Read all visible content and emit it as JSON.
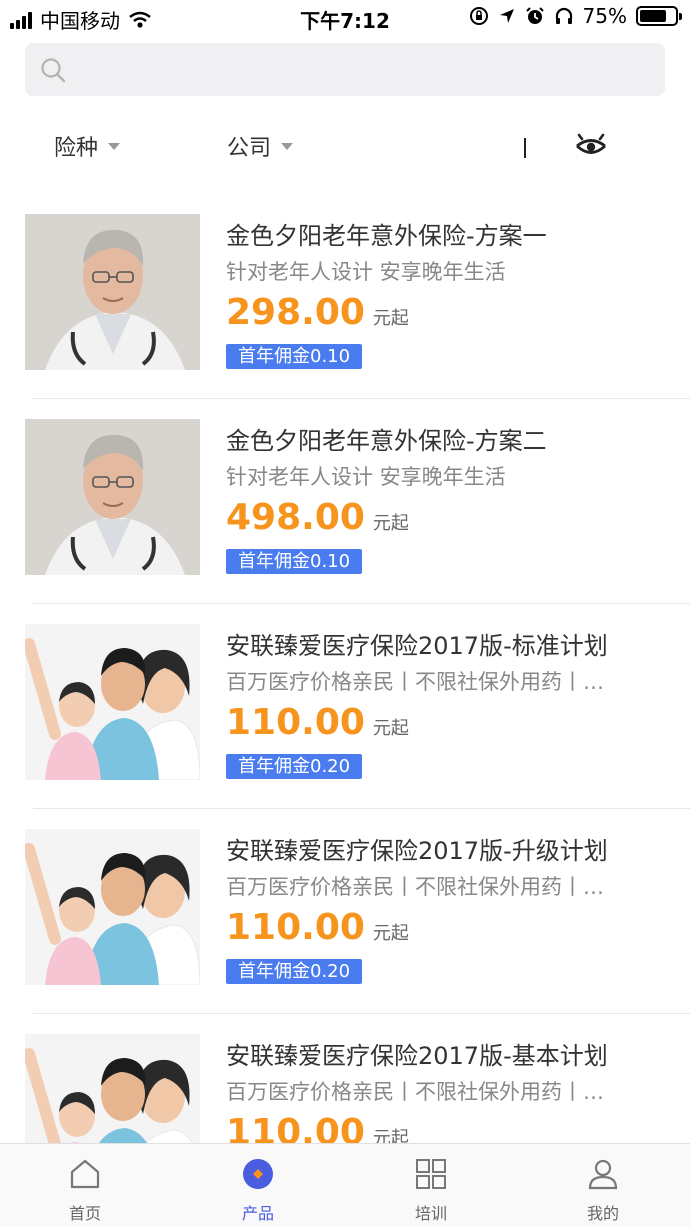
{
  "status_bar": {
    "carrier": "中国移动",
    "time": "下午7:12",
    "battery_percent": "75%",
    "battery_level": 0.75
  },
  "search": {
    "placeholder": ""
  },
  "filters": {
    "insurance_type": "险种",
    "company": "公司"
  },
  "products": [
    {
      "title": "金色夕阳老年意外保险-方案一",
      "desc": "针对老年人设计 安享晚年生活",
      "price": "298.00",
      "unit": "元起",
      "badge": "首年佣金0.10",
      "image": "elderly-doctor-photo"
    },
    {
      "title": "金色夕阳老年意外保险-方案二",
      "desc": "针对老年人设计 安享晚年生活",
      "price": "498.00",
      "unit": "元起",
      "badge": "首年佣金0.10",
      "image": "elderly-doctor-photo"
    },
    {
      "title": "安联臻爱医疗保险2017版-标准计划",
      "desc": "百万医疗价格亲民丨不限社保外用药丨…",
      "price": "110.00",
      "unit": "元起",
      "badge": "首年佣金0.20",
      "image": "family-photo"
    },
    {
      "title": "安联臻爱医疗保险2017版-升级计划",
      "desc": "百万医疗价格亲民丨不限社保外用药丨…",
      "price": "110.00",
      "unit": "元起",
      "badge": "首年佣金0.20",
      "image": "family-photo"
    },
    {
      "title": "安联臻爱医疗保险2017版-基本计划",
      "desc": "百万医疗价格亲民丨不限社保外用药丨…",
      "price": "110.00",
      "unit": "元起",
      "badge": "",
      "image": "family-photo"
    }
  ],
  "tab_bar": {
    "home": "首页",
    "products": "产品",
    "training": "培训",
    "mine": "我的",
    "active": "products"
  },
  "colors": {
    "price": "#f7941d",
    "badge": "#4a7cf0",
    "active_tab": "#4a5ce0",
    "active_tab_dot": "#f7941d"
  }
}
